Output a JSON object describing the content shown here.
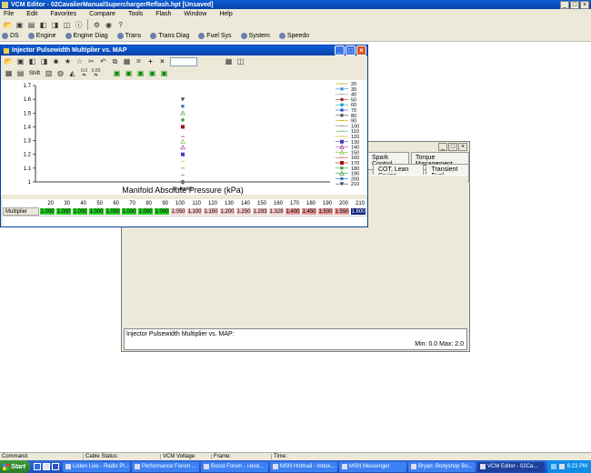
{
  "app": {
    "title": "VCM Editor - 02CavalierManualSuperchargerReflash.hpt   [Unsaved]",
    "menu": [
      "File",
      "Edit",
      "Favorites",
      "Compare",
      "Tools",
      "Flash",
      "Window",
      "Help"
    ],
    "modules": [
      "DS",
      "Engine",
      "Engine Diag",
      "Trans",
      "Trans Diag",
      "Fuel Sys",
      "System",
      "Speedo"
    ]
  },
  "colors": {
    "titlebar": "#0a4fd0",
    "low": "#22cc22",
    "mid": "#f4c4c4",
    "high": "#e89898",
    "selected": "#102080",
    "desktop": "#ffffff"
  },
  "back_window": {
    "tabs": [
      "Spark Control",
      "Torque Management"
    ],
    "subtabs": [
      "COT, Lean Cruise",
      "Transient Fuel"
    ],
    "status_label": "Injector Pulsewidth Multiplier vs. MAP:",
    "minmax": "Min: 0.0 Max: 2.0"
  },
  "table_window": {
    "title": "Injector Pulsewidth Multiplier vs. MAP",
    "toolbar_labels": [
      "0.0",
      "0.00",
      "Shift"
    ],
    "row_label": "Multiplier",
    "x_axis_title": "Manifold Absolute Pressure (kPa)",
    "col_headers": [
      "20",
      "30",
      "40",
      "50",
      "60",
      "70",
      "80",
      "90",
      "100",
      "110",
      "120",
      "130",
      "140",
      "150",
      "160",
      "170",
      "180",
      "190",
      "200",
      "210"
    ],
    "values": [
      "1.000",
      "1.000",
      "1.000",
      "1.000",
      "1.000",
      "1.000",
      "1.000",
      "1.000",
      "1.050",
      "1.100",
      "1.150",
      "1.200",
      "1.250",
      "1.293",
      "1.329",
      "1.400",
      "1.450",
      "1.500",
      "1.550",
      "1.600"
    ]
  },
  "chart_data": {
    "type": "scatter",
    "x_tick_label": "Multiplier",
    "y_ticks": [
      "1",
      "1.1",
      "1.2",
      "1.3",
      "1.4",
      "1.5",
      "1.6",
      "1.7"
    ],
    "ylim": [
      1,
      1.7
    ],
    "series": [
      {
        "name": "20",
        "value": 1.0,
        "color": "#c0a000",
        "marker": "line"
      },
      {
        "name": "30",
        "value": 1.0,
        "color": "#2080e0",
        "marker": "star"
      },
      {
        "name": "40",
        "value": 1.0,
        "color": "#a0a0a0",
        "marker": "line"
      },
      {
        "name": "50",
        "value": 1.0,
        "color": "#a02020",
        "marker": "dot"
      },
      {
        "name": "60",
        "value": 1.0,
        "color": "#20a0c0",
        "marker": "dot"
      },
      {
        "name": "70",
        "value": 1.0,
        "color": "#2040c0",
        "marker": "star"
      },
      {
        "name": "80",
        "value": 1.0,
        "color": "#404040",
        "marker": "star"
      },
      {
        "name": "90",
        "value": 1.0,
        "color": "#e0a000",
        "marker": "line"
      },
      {
        "name": "100",
        "value": 1.05,
        "color": "#808080",
        "marker": "line"
      },
      {
        "name": "110",
        "value": 1.1,
        "color": "#40c040",
        "marker": "line"
      },
      {
        "name": "120",
        "value": 1.15,
        "color": "#c0c040",
        "marker": "line"
      },
      {
        "name": "130",
        "value": 1.2,
        "color": "#4040c0",
        "marker": "square"
      },
      {
        "name": "140",
        "value": 1.25,
        "color": "#a040a0",
        "marker": "triangle"
      },
      {
        "name": "150",
        "value": 1.293,
        "color": "#80c040",
        "marker": "triangle"
      },
      {
        "name": "160",
        "value": 1.329,
        "color": "#c04040",
        "marker": "line"
      },
      {
        "name": "170",
        "value": 1.4,
        "color": "#a01010",
        "marker": "square"
      },
      {
        "name": "180",
        "value": 1.45,
        "color": "#40a040",
        "marker": "dot"
      },
      {
        "name": "190",
        "value": 1.5,
        "color": "#40a040",
        "marker": "triangle"
      },
      {
        "name": "200",
        "value": 1.55,
        "color": "#2060c0",
        "marker": "star"
      },
      {
        "name": "210",
        "value": 1.6,
        "color": "#404060",
        "marker": "triangle-down"
      }
    ]
  },
  "statusbar": {
    "command": "Command:",
    "cable": "Cable Status:",
    "voltage": "VCM Voltage:",
    "frame": "Frame:",
    "time": "Time:"
  },
  "taskbar": {
    "start": "Start",
    "items": [
      "Listen Live - Radio Pl...",
      "Performance Forum ...",
      "Boost Forum - i-bod...",
      "MSN Hotmail - Inbox...",
      "MSN Messenger",
      "Bryan: Bodyshop Bo...",
      "VCM Editor - 02Ca..."
    ],
    "clock": "6:23 PM"
  }
}
